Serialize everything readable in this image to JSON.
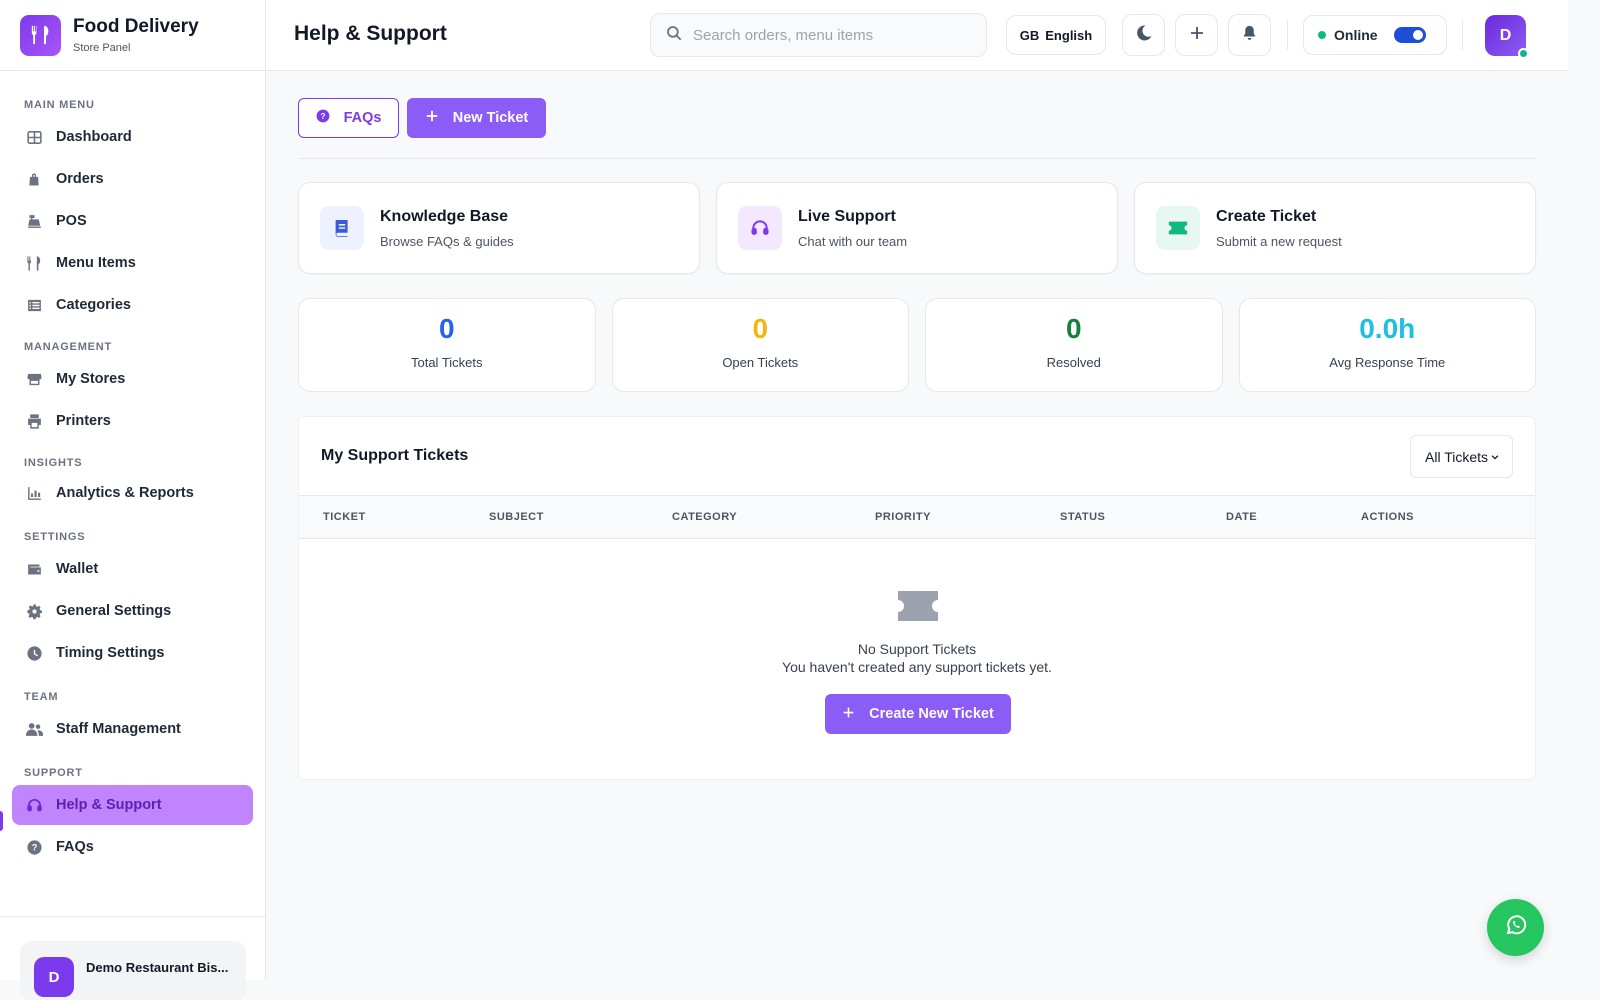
{
  "brand": {
    "title": "Food Delivery",
    "subtitle": "Store Panel"
  },
  "sidebar": {
    "sections": [
      {
        "title": "MAIN MENU",
        "items": [
          {
            "label": "Dashboard",
            "icon": "grid-icon"
          },
          {
            "label": "Orders",
            "icon": "shopping-bag-icon"
          },
          {
            "label": "POS",
            "icon": "cash-register-icon"
          },
          {
            "label": "Menu Items",
            "icon": "utensils-icon"
          },
          {
            "label": "Categories",
            "icon": "list-icon"
          }
        ]
      },
      {
        "title": "MANAGEMENT",
        "items": [
          {
            "label": "My Stores",
            "icon": "store-icon"
          },
          {
            "label": "Printers",
            "icon": "printer-icon"
          }
        ]
      },
      {
        "title": "INSIGHTS",
        "items": [
          {
            "label": "Analytics & Reports",
            "icon": "chart-icon"
          }
        ]
      },
      {
        "title": "SETTINGS",
        "items": [
          {
            "label": "Wallet",
            "icon": "wallet-icon"
          },
          {
            "label": "General Settings",
            "icon": "gear-icon"
          },
          {
            "label": "Timing Settings",
            "icon": "clock-icon"
          }
        ]
      },
      {
        "title": "TEAM",
        "items": [
          {
            "label": "Staff Management",
            "icon": "users-icon"
          }
        ]
      },
      {
        "title": "SUPPORT",
        "items": [
          {
            "label": "Help & Support",
            "icon": "headset-icon",
            "active": true
          },
          {
            "label": "FAQs",
            "icon": "question-circle-icon"
          }
        ]
      }
    ],
    "user": {
      "initial": "D",
      "name": "Demo Restaurant Bis..."
    }
  },
  "header": {
    "title": "Help & Support",
    "search_placeholder": "Search orders, menu items",
    "language": {
      "code": "GB",
      "label": "English"
    },
    "status_label": "Online",
    "avatar_initial": "D"
  },
  "actions": {
    "faqs_label": "FAQs",
    "new_ticket_label": "New Ticket"
  },
  "quick_cards": [
    {
      "title": "Knowledge Base",
      "subtitle": "Browse FAQs & guides",
      "icon": "book-icon",
      "bg": "#eef2ff",
      "color": "#3b5bdb"
    },
    {
      "title": "Live Support",
      "subtitle": "Chat with our team",
      "icon": "headset-icon",
      "bg": "#f3e8ff",
      "color": "#7c3aed"
    },
    {
      "title": "Create Ticket",
      "subtitle": "Submit a new request",
      "icon": "ticket-icon",
      "bg": "#e7f8f1",
      "color": "#10b981"
    }
  ],
  "stats": [
    {
      "value": "0",
      "label": "Total Tickets",
      "color": "#2563eb"
    },
    {
      "value": "0",
      "label": "Open Tickets",
      "color": "#f5b50b"
    },
    {
      "value": "0",
      "label": "Resolved",
      "color": "#15803d"
    },
    {
      "value": "0.0h",
      "label": "Avg Response Time",
      "color": "#1ec0e0"
    }
  ],
  "tickets": {
    "title": "My Support Tickets",
    "filter_value": "All Tickets",
    "columns": [
      "TICKET",
      "SUBJECT",
      "CATEGORY",
      "PRIORITY",
      "STATUS",
      "DATE",
      "ACTIONS"
    ],
    "empty_title": "No Support Tickets",
    "empty_subtitle": "You haven't created any support tickets yet.",
    "create_label": "Create New Ticket"
  }
}
